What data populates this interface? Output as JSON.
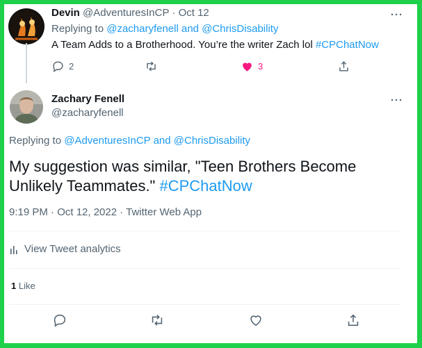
{
  "reply_tweet": {
    "author_name": "Devin",
    "author_handle": "@AdventuresInCP",
    "separator": " · ",
    "date": "Oct 12",
    "replying_prefix": "Replying to ",
    "mention_1": "@zacharyfenell",
    "conjunction": " and ",
    "mention_2": "@ChrisDisability",
    "text": "A Team Adds to a Brotherhood. You’re the writer Zach lol ",
    "hashtag": "#CPChatNow",
    "reply_count": "2",
    "like_count": "3",
    "more_label": "···"
  },
  "main_tweet": {
    "author_name": "Zachary Fenell",
    "author_handle": "@zacharyfenell",
    "replying_prefix": "Replying to ",
    "mention_1": "@AdventuresInCP",
    "conjunction": " and ",
    "mention_2": "@ChrisDisability",
    "text": "My suggestion was similar, \"Teen Brothers Become Unlikely Teammates.\" ",
    "hashtag": "#CPChatNow",
    "meta": "9:19 PM · Oct 12, 2022 · Twitter Web App",
    "analytics_label": "View Tweet analytics",
    "like_total": "1",
    "like_word": " Like",
    "more_label": "···"
  },
  "icons": [
    "reply-icon",
    "retweet-icon",
    "like-icon",
    "share-icon",
    "analytics-icon"
  ],
  "colors": {
    "frame": "#1fd14a",
    "accent": "#1d9bf0",
    "like": "#f91880",
    "muted": "#536471"
  }
}
